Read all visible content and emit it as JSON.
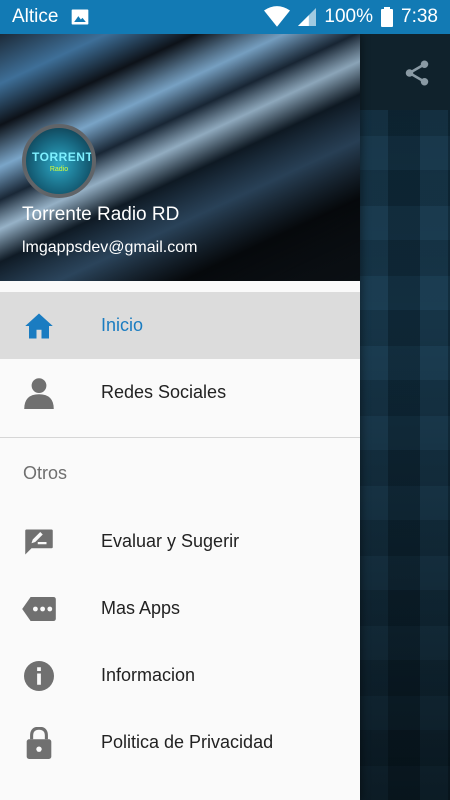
{
  "status_bar": {
    "carrier": "Altice",
    "battery": "100%",
    "time": "7:38"
  },
  "drawer": {
    "header": {
      "app_name": "Torrente Radio RD",
      "email": "lmgappsdev@gmail.com",
      "avatar_text": "TORRENTE",
      "avatar_subtext": "Radio"
    },
    "items": [
      {
        "label": "Inicio",
        "icon": "home-icon",
        "active": true
      },
      {
        "label": "Redes Sociales",
        "icon": "person-icon",
        "active": false
      }
    ],
    "section_title": "Otros",
    "other_items": [
      {
        "label": "Evaluar y Sugerir",
        "icon": "rate-review-icon"
      },
      {
        "label": "Mas Apps",
        "icon": "more-apps-icon"
      },
      {
        "label": "Informacion",
        "icon": "info-icon"
      },
      {
        "label": "Politica de Privacidad",
        "icon": "lock-icon"
      }
    ]
  },
  "colors": {
    "status_bar": "#127ab4",
    "accent": "#1a7cc1",
    "active_bg": "#dcdcdc",
    "icon_gray": "#707070"
  }
}
